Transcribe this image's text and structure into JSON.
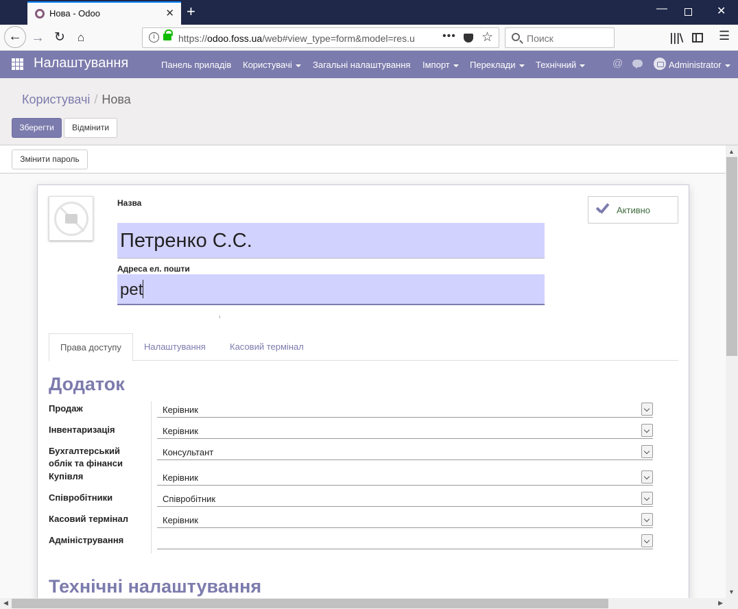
{
  "browser": {
    "tab_title": "Нова - Odoo",
    "new_tab_symbol": "+",
    "tab_close_symbol": "✕",
    "url_prefix": "https://",
    "url_host": "odoo.foss.ua",
    "url_rest": "/web#view_type=form&model=res.u",
    "search_placeholder": "Поиск",
    "win_minimize": "—",
    "win_close": "✕"
  },
  "navbar": {
    "app_title": "Налаштування",
    "menu": [
      {
        "label": "Панель приладів",
        "dropdown": false
      },
      {
        "label": "Користувачі",
        "dropdown": true
      },
      {
        "label": "Загальні налаштування",
        "dropdown": false
      },
      {
        "label": "Імпорт",
        "dropdown": true
      },
      {
        "label": "Переклади",
        "dropdown": true
      },
      {
        "label": "Технічний",
        "dropdown": true
      }
    ],
    "user": "Administrator"
  },
  "breadcrumb": {
    "parent": "Користувачі",
    "separator": "/",
    "current": "Нова"
  },
  "buttons": {
    "save": "Зберегти",
    "discard": "Відмінити",
    "change_password": "Змінити пароль",
    "active": "Активно"
  },
  "form": {
    "name_label": "Назва",
    "name_value": "Петренко С.С.",
    "email_label": "Адреса ел. пошти",
    "email_value": "pet"
  },
  "tabs": [
    {
      "label": "Права доступу",
      "active": true
    },
    {
      "label": "Налаштування",
      "active": false
    },
    {
      "label": "Касовий термінал",
      "active": false
    }
  ],
  "sections": {
    "application": "Додаток",
    "technical": "Технічні налаштування"
  },
  "permissions": [
    {
      "label": "Продаж",
      "value": "Керівник"
    },
    {
      "label": "Інвентаризація",
      "value": "Керівник"
    },
    {
      "label": "Бухгалтерський облік та фінанси",
      "value": "Консультант"
    },
    {
      "label": "Купівля",
      "value": "Керівник"
    },
    {
      "label": "Співробітники",
      "value": "Співробітник"
    },
    {
      "label": "Касовий термінал",
      "value": "Керівник"
    },
    {
      "label": "Адміністрування",
      "value": ""
    }
  ],
  "colors": {
    "brand": "#7c7bad",
    "input_required": "#d2d2ff",
    "browser_titlebar": "#1f2849"
  }
}
